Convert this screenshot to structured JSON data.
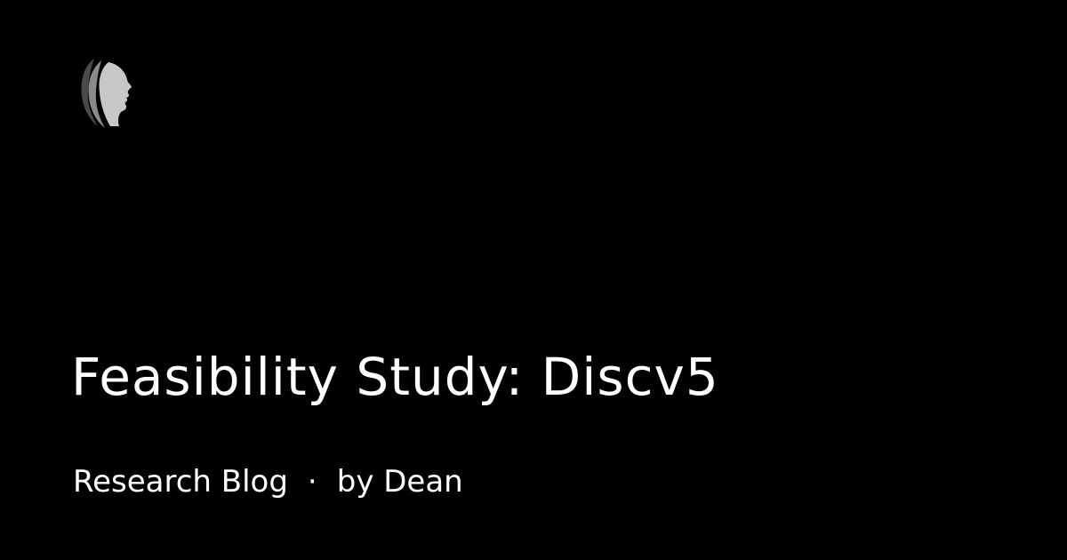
{
  "post": {
    "title": "Feasibility Study: Discv5",
    "section": "Research Blog",
    "separator": "·",
    "byline": "by Dean"
  },
  "brand": {
    "logo_icon": "profile-silhouette-logo-icon"
  },
  "colors": {
    "background": "#000000",
    "text": "#ffffff",
    "logo_light": "#c7c7c7",
    "logo_mid": "#8a8a8a",
    "logo_dark": "#4a4a4a"
  }
}
